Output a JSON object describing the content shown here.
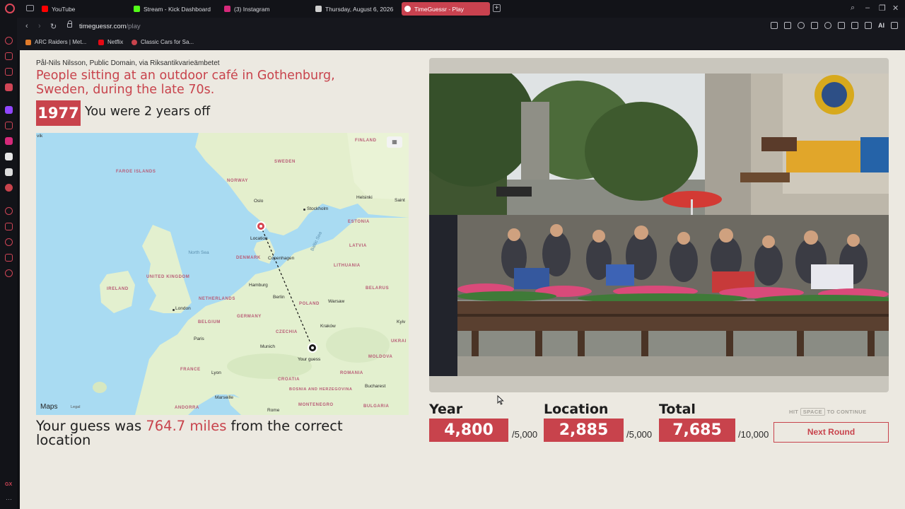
{
  "browser": {
    "tabs": [
      {
        "label": "YouTube",
        "color": "#ff0000"
      },
      {
        "label": "Stream - Kick Dashboard",
        "color": "#53fc18"
      },
      {
        "label": "(3) Instagram",
        "color": "#d6297a"
      },
      {
        "label": "Thursday, August 6, 2026",
        "color": "#cfcfcf"
      },
      {
        "label": "TimeGuessr - Play",
        "color": "#ffffff",
        "active": true
      }
    ],
    "address": {
      "host": "timeguessr.com",
      "path": "/play"
    },
    "toolbar_ai": "AI",
    "bookmarks": [
      {
        "label": "ARC Raiders | Met...",
        "color": "#e07b2a"
      },
      {
        "label": "Netflix",
        "color": "#e50914"
      },
      {
        "label": "Classic Cars for Sa...",
        "color": "#c8434c"
      }
    ],
    "sidebar_gx": "GX"
  },
  "result": {
    "credit": "Pål-Nils Nilsson, Public Domain, via Riksantikvarieämbetet",
    "caption": "People sitting at an outdoor café in Gothenburg, Sweden, during the late 70s.",
    "year": "1977",
    "years_off": "You were 2 years off",
    "distance_prefix": "Your guess was ",
    "distance_value": "764.7 miles",
    "distance_suffix": " from the correct location"
  },
  "map": {
    "labels": {
      "finland": "FINLAND",
      "sweden": "SWEDEN",
      "norway": "NORWAY",
      "faroe": "FAROE ISLANDS",
      "oslo": "Oslo",
      "stockholm": "Stockholm",
      "helsinki": "Helsinki",
      "saint": "Saint",
      "estonia": "ESTONIA",
      "latvia": "LATVIA",
      "lithuania": "LITHUANIA",
      "belarus": "BELARUS",
      "north_sea": "North Sea",
      "baltic_sea": "Baltic Sea",
      "denmark": "DENMARK",
      "copenhagen": "Copenhagen",
      "uk": "UNITED KINGDOM",
      "ireland": "IRELAND",
      "london": "London",
      "hamburg": "Hamburg",
      "netherlands": "NETHERLANDS",
      "berlin": "Berlin",
      "poland": "POLAND",
      "warsaw": "Warsaw",
      "belgium": "BELGIUM",
      "germany": "GERMANY",
      "czechia": "CZECHIA",
      "krakow": "Kraków",
      "kyiv": "Kyiv",
      "ukraine": "UKRAI",
      "paris": "Paris",
      "munich": "Munich",
      "france": "FRANCE",
      "lyon": "Lyon",
      "croatia": "CROATIA",
      "romania": "ROMANIA",
      "moldova": "MOLDOVA",
      "bucharest": "Bucharest",
      "marseille": "Marseille",
      "bosnia": "BOSNIA AND HERZEGOVINA",
      "montenegro": "MONTENEGRO",
      "bulgaria": "BULGARIA",
      "andorra": "ANDORRA",
      "rome": "Rome",
      "vik": "vík",
      "location_pin": "Location",
      "guess_pin": "Your guess",
      "maps_logo": "Maps",
      "legal": "Legal"
    }
  },
  "scores": {
    "year": {
      "title": "Year",
      "value": "4,800",
      "max": "/5,000"
    },
    "location": {
      "title": "Location",
      "value": "2,885",
      "max": "/5,000"
    },
    "total": {
      "title": "Total",
      "value": "7,685",
      "max": "/10,000"
    },
    "hint_prefix": "HIT",
    "hint_key": "SPACE",
    "hint_suffix": "TO CONTINUE",
    "next_label": "Next Round"
  },
  "colors": {
    "accent": "#c8434c",
    "page_bg": "#ece9e1",
    "sea": "#a9dbf2",
    "land": "#e3f0cf"
  }
}
